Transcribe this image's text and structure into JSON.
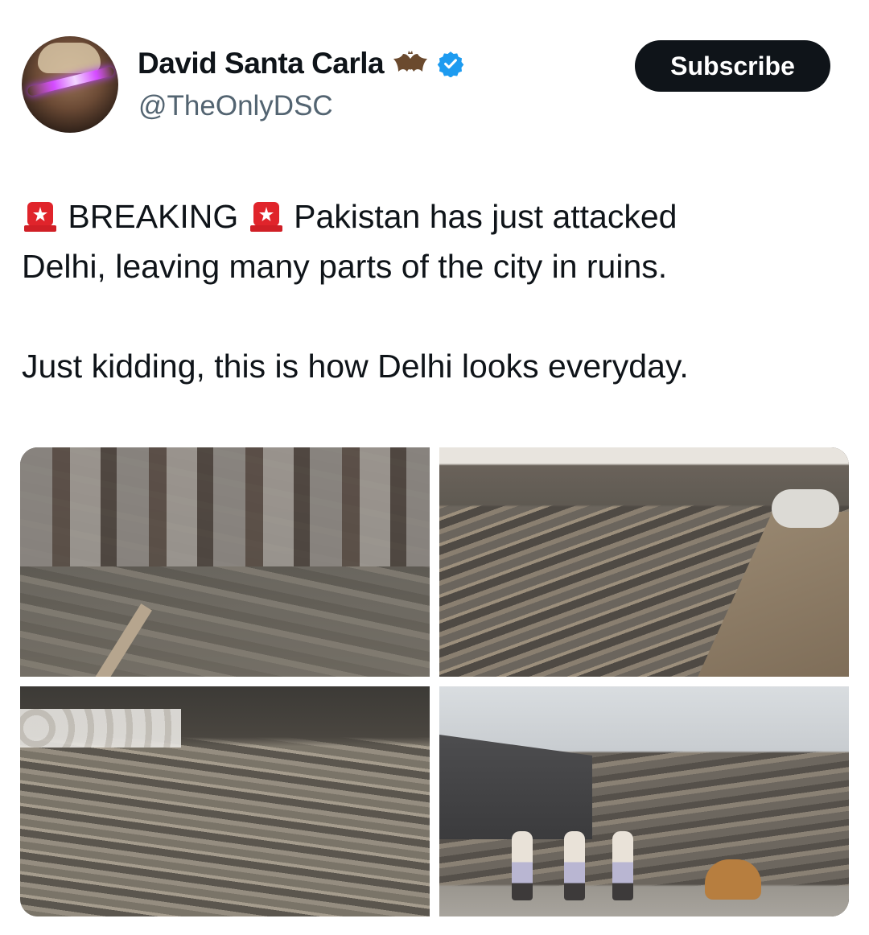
{
  "author": {
    "display_name": "David Santa Carla",
    "handle": "@TheOnlyDSC",
    "name_emoji": "bat-icon",
    "verified_badge": "verified-icon",
    "verified_color": "#1d9bf0"
  },
  "actions": {
    "subscribe_label": "Subscribe"
  },
  "tweet": {
    "line1_breaking": "BREAKING",
    "line1_rest": "Pakistan has just attacked",
    "line2": "Delhi, leaving many parts of the city in ruins.",
    "line3": "Just kidding, this is how Delhi looks everyday.",
    "emoji": "police-siren-icon"
  },
  "media": [
    {
      "name": "photo-slum-garbage-canal"
    },
    {
      "name": "photo-garbage-filled-drain-with-porter"
    },
    {
      "name": "photo-landfill-with-animals"
    },
    {
      "name": "photo-schoolchildren-by-garbage-drain"
    }
  ],
  "colors": {
    "text": "#0f1419",
    "secondary_text": "#536471",
    "button_bg": "#0f1419",
    "siren_red": "#e0242b"
  }
}
